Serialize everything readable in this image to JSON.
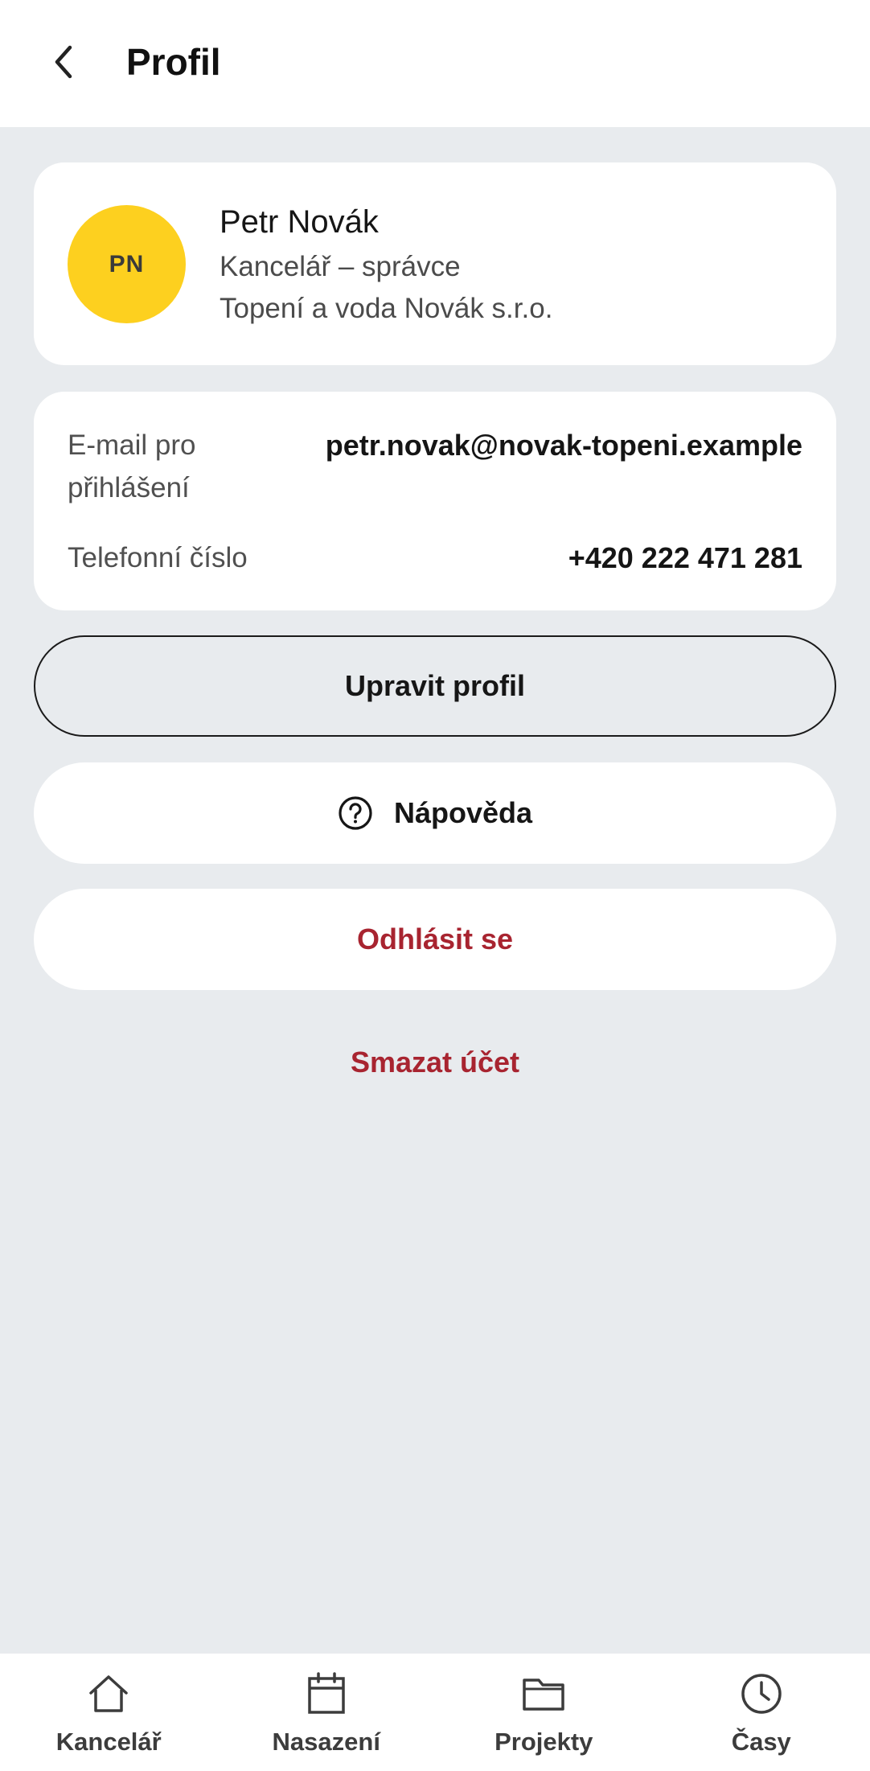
{
  "header": {
    "title": "Profil",
    "back_icon": "chevron-left-icon"
  },
  "profile": {
    "initials": "PN",
    "name": "Petr Novák",
    "role": "Kancelář – správce",
    "company": "Topení a voda Novák s.r.o.",
    "avatar_color": "#fdd01f"
  },
  "info": {
    "email_label": "E-mail pro přihlášení",
    "email_value": "petr.novak@novak-topeni.example",
    "phone_label": "Telefonní číslo",
    "phone_value": "+420 222 471 281"
  },
  "actions": {
    "edit_label": "Upravit profil",
    "help_label": "Nápověda",
    "logout_label": "Odhlásit se",
    "delete_label": "Smazat účet",
    "danger_color": "#a82430"
  },
  "bottom_nav": {
    "items": [
      {
        "label": "Kancelář",
        "icon": "home-icon"
      },
      {
        "label": "Nasazení",
        "icon": "calendar-icon"
      },
      {
        "label": "Projekty",
        "icon": "folder-icon"
      },
      {
        "label": "Časy",
        "icon": "clock-icon"
      }
    ]
  }
}
